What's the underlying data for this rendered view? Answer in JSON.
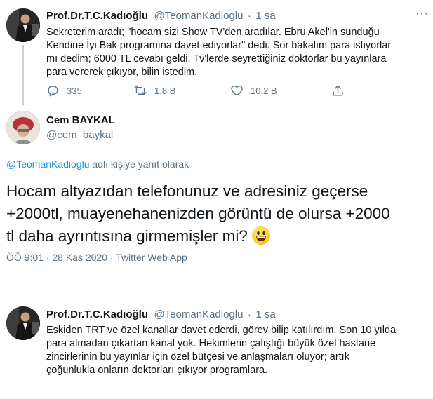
{
  "tweet1": {
    "name": "Prof.Dr.T.C.Kadıoğlu",
    "handle": "@TeomanKadioglu",
    "dot": "·",
    "time": "1 sa",
    "text": "Sekreterim aradı; \"hocam sizi Show TV'den aradılar. Ebru Akel'in sunduğu\nKendine İyi Bak programına davet ediyorlar\" dedi. Sor bakalım para istiyorlar\nmı dedim; 6000 TL cevabı geldi. Tv'lerde seyrettiğiniz doktorlar bu yayınlara\npara vererek çıkıyor, bilin istedim.",
    "replies": "335",
    "retweets": "1,8 B",
    "likes": "10,2 B",
    "more_icon": "more-icon"
  },
  "tweet2": {
    "name": "Cem BAYKAL",
    "handle": "@cem_baykal",
    "reply_to_handle": "@TeomanKadioglu",
    "reply_to_suffix": " adlı kişiye yanıt olarak",
    "text": "Hocam altyazıdan telefonunuz ve adresiniz geçerse\n+2000tl, muayenehanenizden görüntü de olursa +2000\ntl daha ayrıntısına girmemişler mi?",
    "emoji": "grinning-face-emoji",
    "meta": "ÖÖ 9:01 · 28 Kas 2020 · Twitter Web App"
  },
  "tweet3": {
    "name": "Prof.Dr.T.C.Kadıoğlu",
    "handle": "@TeomanKadioglu",
    "dot": "·",
    "time": "1 sa",
    "text": "Eskiden TRT ve özel kanallar davet ederdi, görev bilip katılırdım. Son 10 yılda\npara almadan çıkartan kanal yok. Hekimlerin çalıştığı büyük özel hastane\nzincirlerinin bu yayınlar için özel bütçesi ve anlaşmaları oluyor; artık\nçoğunlukla onların doktorları çıkıyor programlara."
  },
  "colors": {
    "text": "#0f1419",
    "muted": "#5b7083",
    "link": "#1b95e0",
    "thread_line": "#c4cfd6"
  }
}
